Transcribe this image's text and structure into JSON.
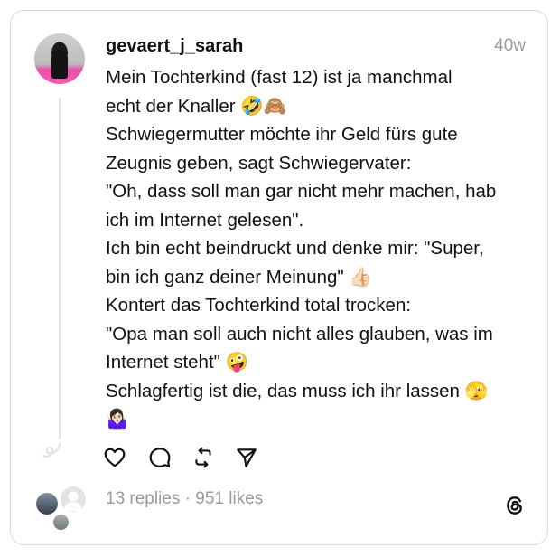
{
  "post": {
    "username": "gevaert_j_sarah",
    "time": "40w",
    "lines": [
      "Mein Tochterkind (fast 12) ist ja manchmal",
      "echt der Knaller 🤣🙈",
      "Schwiegermutter möchte ihr Geld fürs gute",
      "Zeugnis geben, sagt Schwiegervater:",
      "\"Oh, dass soll man gar nicht mehr machen, hab",
      "ich im Internet gelesen\".",
      "Ich bin echt beindruckt und denke mir: \"Super,",
      "bin ich ganz deiner Meinung\" 👍🏻",
      "Kontert das Tochterkind total trocken:",
      "\"Opa man soll auch nicht alles glauben, was im",
      "Internet steht\" 🤪",
      "Schlagfertig ist die, das muss ich ihr lassen 🫣",
      "🤷🏻‍♀️"
    ]
  },
  "actions": {
    "icons": [
      "heart-icon",
      "comment-icon",
      "repost-icon",
      "share-icon"
    ]
  },
  "stats": {
    "summary": "13 replies · 951 likes"
  },
  "colors": {
    "text": "#111111",
    "muted": "#9a9a9a",
    "border": "#d9d9d9",
    "thread_line": "#e2e2e2"
  }
}
